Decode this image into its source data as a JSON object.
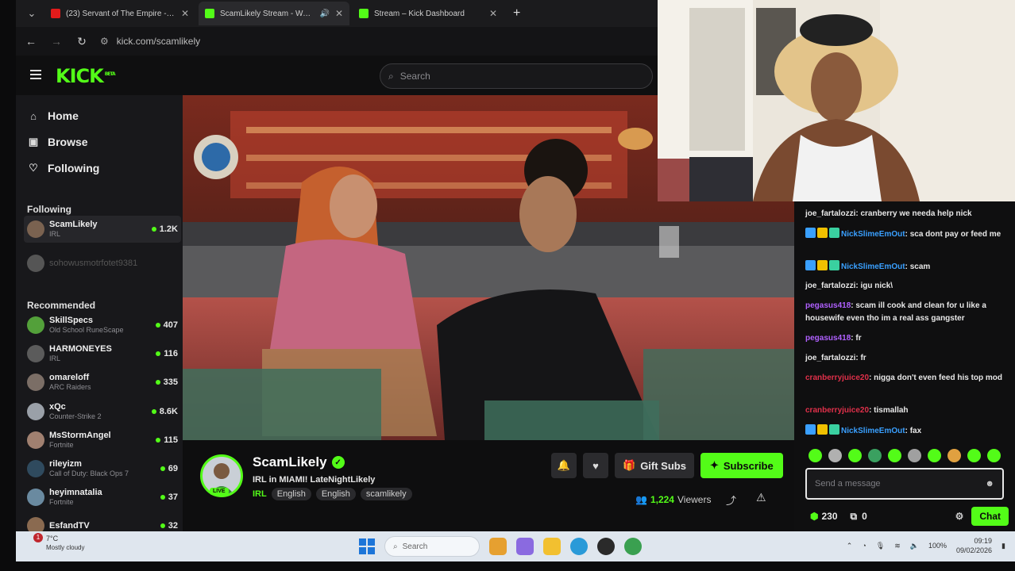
{
  "tabs": [
    {
      "title": "(23) Servant of The Empire - Fu",
      "color": "#e31b1b"
    },
    {
      "title": "ScamLikely Stream - Watch",
      "color": "#53fc18",
      "active": true
    },
    {
      "title": "Stream – Kick Dashboard",
      "color": "#53fc18"
    }
  ],
  "address": {
    "url": "kick.com/scamlikely"
  },
  "header": {
    "logo": "KICK",
    "logo_sup": "BETA",
    "search_placeholder": "Search"
  },
  "sidebar": {
    "nav": [
      {
        "label": "Home",
        "icon": "home-icon"
      },
      {
        "label": "Browse",
        "icon": "browse-icon"
      },
      {
        "label": "Following",
        "icon": "heart-icon"
      }
    ],
    "following_title": "Following",
    "following": [
      {
        "name": "ScamLikely",
        "game": "IRL",
        "viewers": "1.2K",
        "avatar": "#7a6250",
        "selected": true
      },
      {
        "name": "sohowusmotrfotet9381",
        "game": "",
        "viewers": "",
        "avatar": "#555",
        "faded": true
      }
    ],
    "recommended_title": "Recommended",
    "recommended": [
      {
        "name": "SkillSpecs",
        "game": "Old School RuneScape",
        "viewers": "407",
        "avatar": "#53a03a"
      },
      {
        "name": "HARMONEYES",
        "game": "IRL",
        "viewers": "116",
        "avatar": "#5b5b5b"
      },
      {
        "name": "omareloff",
        "game": "ARC Raiders",
        "viewers": "335",
        "avatar": "#7b6e66"
      },
      {
        "name": "xQc",
        "game": "Counter-Strike 2",
        "viewers": "8.6K",
        "avatar": "#9aa0a8"
      },
      {
        "name": "MsStormAngel",
        "game": "Fortnite",
        "viewers": "115",
        "avatar": "#a08070"
      },
      {
        "name": "rileyizm",
        "game": "Call of Duty: Black Ops 7",
        "viewers": "69",
        "avatar": "#2f4a5e"
      },
      {
        "name": "heyimnatalia",
        "game": "Fortnite",
        "viewers": "37",
        "avatar": "#6a8aa0"
      },
      {
        "name": "EsfandTV",
        "game": "",
        "viewers": "32",
        "avatar": "#8a6a50"
      }
    ]
  },
  "stream": {
    "streamer": "ScamLikely",
    "live": "LIVE",
    "title": "IRL in MIAMI! LateNightLikely",
    "category": "IRL",
    "tags": [
      "English",
      "English",
      "scamlikely"
    ],
    "gift_label": "Gift Subs",
    "subscribe_label": "Subscribe",
    "viewers_count": "1,224",
    "viewers_label": "Viewers"
  },
  "chat": {
    "messages": [
      {
        "user": "joe_fartalozzi",
        "color": "#e8e8e8",
        "text": "cranberry we needa help nick",
        "badges": []
      },
      {
        "user": "NickSlimeEmOut",
        "color": "#3aa0ff",
        "text": "sca dont pay or feed me",
        "badges": [
          "#3aa0ff",
          "#f0c000",
          "#3ad0a0"
        ]
      },
      {
        "user": "NickSlimeEmOut",
        "color": "#3aa0ff",
        "text": "scam",
        "badges": [
          "#3aa0ff",
          "#f0c000",
          "#3ad0a0"
        ]
      },
      {
        "user": "joe_fartalozzi",
        "color": "#e8e8e8",
        "text": "igu nick\\",
        "badges": []
      },
      {
        "user": "pegasus418",
        "color": "#b060ff",
        "text": "scam ill cook and clean for u like a housewife even tho im a real ass gangster",
        "badges": []
      },
      {
        "user": "pegasus418",
        "color": "#b060ff",
        "text": "fr",
        "badges": []
      },
      {
        "user": "joe_fartalozzi",
        "color": "#e8e8e8",
        "text": "fr",
        "badges": []
      },
      {
        "user": "cranberryjuice20",
        "color": "#e0304a",
        "text": "nigga don't even feed his top mod",
        "badges": []
      },
      {
        "user": "cranberryjuice20",
        "color": "#e0304a",
        "text": "tismallah",
        "badges": []
      },
      {
        "user": "NickSlimeEmOut",
        "color": "#3aa0ff",
        "text": "fax",
        "badges": [
          "#3aa0ff",
          "#f0c000",
          "#3ad0a0"
        ]
      }
    ],
    "input_placeholder": "Send a message",
    "points": "230",
    "drops": "0",
    "chat_button": "Chat"
  },
  "taskbar": {
    "temp": "7°C",
    "weather": "Mostly cloudy",
    "notifications": "1",
    "search_placeholder": "Search",
    "battery": "100%",
    "time": "09:19",
    "date": "09/02/2026"
  }
}
